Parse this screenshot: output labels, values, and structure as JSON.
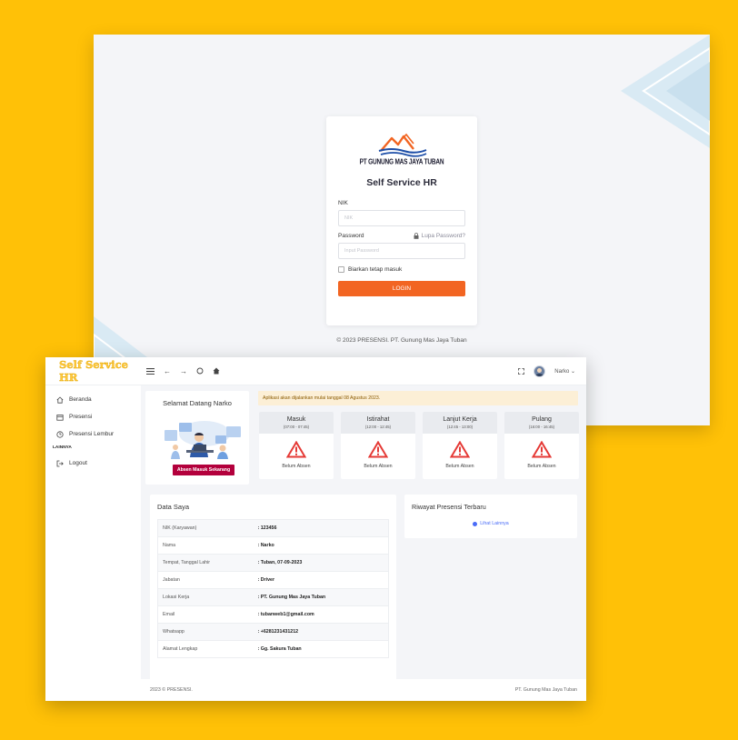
{
  "colors": {
    "background": "#FFC107",
    "accent": "#F26522",
    "absen_button": "#B3003C",
    "brand": "#FFC940",
    "warning_icon": "#E53935"
  },
  "login": {
    "logo_text": "PT GUNUNG MAS JAYA TUBAN",
    "title": "Self Service HR",
    "nik_label": "NIK",
    "nik_placeholder": "NIK",
    "password_label": "Password",
    "forgot_label": "Lupa Password?",
    "password_placeholder": "Input Password",
    "remember_label": "Biarkan tetap masuk",
    "login_button": "LOGIN",
    "copyright": "© 2023 PRESENSI. PT. Gunung Mas Jaya Tuban"
  },
  "dashboard": {
    "brand": "Self Service HR",
    "user_name": "Narko",
    "sidebar": {
      "items": [
        {
          "label": "Beranda",
          "icon": "home-icon"
        },
        {
          "label": "Presensi",
          "icon": "calendar-icon"
        },
        {
          "label": "Presensi Lembur",
          "icon": "clock-icon"
        }
      ],
      "section_header": "LAINNYA",
      "logout_label": "Logout"
    },
    "welcome": {
      "title": "Selamat Datang Narko",
      "button": "Absen Masuk Sekarang"
    },
    "notice": "Aplikasi akan dijalankan mulai tanggal 08 Agustus 2023.",
    "attendance": [
      {
        "name": "Masuk",
        "time": "(07:00 - 07:45)",
        "status": "Belum Absen"
      },
      {
        "name": "Istirahat",
        "time": "(12:00 - 12:45)",
        "status": "Belum Absen"
      },
      {
        "name": "Lanjut Kerja",
        "time": "(12:45 - 13:00)",
        "status": "Belum Absen"
      },
      {
        "name": "Pulang",
        "time": "(16:00 - 16:45)",
        "status": "Belum Absen"
      }
    ],
    "data_saya": {
      "title": "Data Saya",
      "rows": [
        {
          "key": "NIK (Karyawan)",
          "value": ": 123456"
        },
        {
          "key": "Nama",
          "value": ": Narko"
        },
        {
          "key": "Tempat, Tanggal Lahir",
          "value": ": Tuban, 07-09-2023"
        },
        {
          "key": "Jabatan",
          "value": ": Driver"
        },
        {
          "key": "Lokasi Kerja",
          "value": ": PT. Gunung Mas Jaya Tuban"
        },
        {
          "key": "Email",
          "value": ": tubanweb1@gmail.com"
        },
        {
          "key": "Whatsapp",
          "value": ": +6281231431212"
        },
        {
          "key": "Alamat Lengkap",
          "value": ": Gg. Sakura Tuban"
        }
      ]
    },
    "riwayat": {
      "title": "Riwayat Presensi Terbaru",
      "link": "Lihat Lainnya"
    },
    "footer": {
      "left": "2023 © PRESENSI.",
      "right": "PT. Gunung Mas Jaya Tuban"
    }
  }
}
